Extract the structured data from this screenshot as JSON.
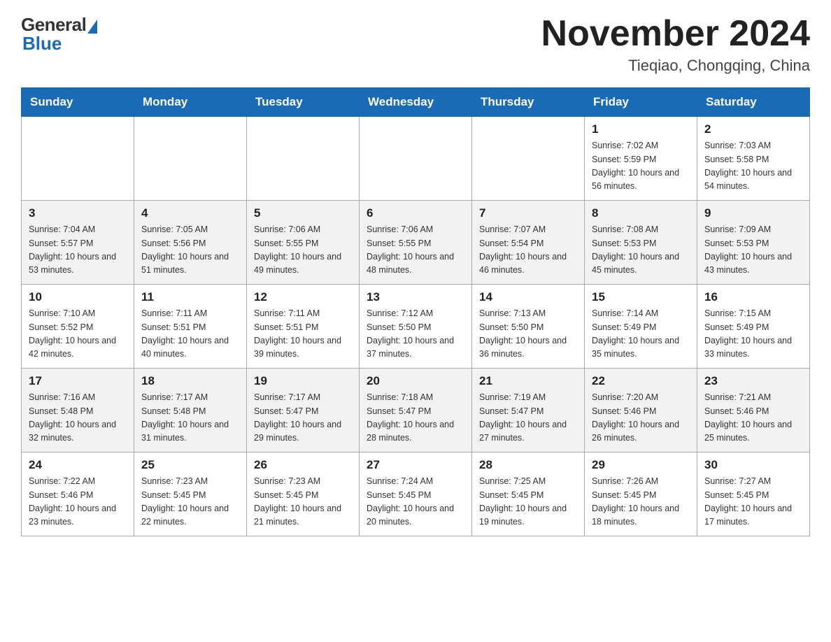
{
  "header": {
    "logo_general": "General",
    "logo_blue": "Blue",
    "month_title": "November 2024",
    "location": "Tieqiao, Chongqing, China"
  },
  "weekdays": [
    "Sunday",
    "Monday",
    "Tuesday",
    "Wednesday",
    "Thursday",
    "Friday",
    "Saturday"
  ],
  "weeks": [
    [
      {
        "day": "",
        "info": ""
      },
      {
        "day": "",
        "info": ""
      },
      {
        "day": "",
        "info": ""
      },
      {
        "day": "",
        "info": ""
      },
      {
        "day": "",
        "info": ""
      },
      {
        "day": "1",
        "info": "Sunrise: 7:02 AM\nSunset: 5:59 PM\nDaylight: 10 hours and 56 minutes."
      },
      {
        "day": "2",
        "info": "Sunrise: 7:03 AM\nSunset: 5:58 PM\nDaylight: 10 hours and 54 minutes."
      }
    ],
    [
      {
        "day": "3",
        "info": "Sunrise: 7:04 AM\nSunset: 5:57 PM\nDaylight: 10 hours and 53 minutes."
      },
      {
        "day": "4",
        "info": "Sunrise: 7:05 AM\nSunset: 5:56 PM\nDaylight: 10 hours and 51 minutes."
      },
      {
        "day": "5",
        "info": "Sunrise: 7:06 AM\nSunset: 5:55 PM\nDaylight: 10 hours and 49 minutes."
      },
      {
        "day": "6",
        "info": "Sunrise: 7:06 AM\nSunset: 5:55 PM\nDaylight: 10 hours and 48 minutes."
      },
      {
        "day": "7",
        "info": "Sunrise: 7:07 AM\nSunset: 5:54 PM\nDaylight: 10 hours and 46 minutes."
      },
      {
        "day": "8",
        "info": "Sunrise: 7:08 AM\nSunset: 5:53 PM\nDaylight: 10 hours and 45 minutes."
      },
      {
        "day": "9",
        "info": "Sunrise: 7:09 AM\nSunset: 5:53 PM\nDaylight: 10 hours and 43 minutes."
      }
    ],
    [
      {
        "day": "10",
        "info": "Sunrise: 7:10 AM\nSunset: 5:52 PM\nDaylight: 10 hours and 42 minutes."
      },
      {
        "day": "11",
        "info": "Sunrise: 7:11 AM\nSunset: 5:51 PM\nDaylight: 10 hours and 40 minutes."
      },
      {
        "day": "12",
        "info": "Sunrise: 7:11 AM\nSunset: 5:51 PM\nDaylight: 10 hours and 39 minutes."
      },
      {
        "day": "13",
        "info": "Sunrise: 7:12 AM\nSunset: 5:50 PM\nDaylight: 10 hours and 37 minutes."
      },
      {
        "day": "14",
        "info": "Sunrise: 7:13 AM\nSunset: 5:50 PM\nDaylight: 10 hours and 36 minutes."
      },
      {
        "day": "15",
        "info": "Sunrise: 7:14 AM\nSunset: 5:49 PM\nDaylight: 10 hours and 35 minutes."
      },
      {
        "day": "16",
        "info": "Sunrise: 7:15 AM\nSunset: 5:49 PM\nDaylight: 10 hours and 33 minutes."
      }
    ],
    [
      {
        "day": "17",
        "info": "Sunrise: 7:16 AM\nSunset: 5:48 PM\nDaylight: 10 hours and 32 minutes."
      },
      {
        "day": "18",
        "info": "Sunrise: 7:17 AM\nSunset: 5:48 PM\nDaylight: 10 hours and 31 minutes."
      },
      {
        "day": "19",
        "info": "Sunrise: 7:17 AM\nSunset: 5:47 PM\nDaylight: 10 hours and 29 minutes."
      },
      {
        "day": "20",
        "info": "Sunrise: 7:18 AM\nSunset: 5:47 PM\nDaylight: 10 hours and 28 minutes."
      },
      {
        "day": "21",
        "info": "Sunrise: 7:19 AM\nSunset: 5:47 PM\nDaylight: 10 hours and 27 minutes."
      },
      {
        "day": "22",
        "info": "Sunrise: 7:20 AM\nSunset: 5:46 PM\nDaylight: 10 hours and 26 minutes."
      },
      {
        "day": "23",
        "info": "Sunrise: 7:21 AM\nSunset: 5:46 PM\nDaylight: 10 hours and 25 minutes."
      }
    ],
    [
      {
        "day": "24",
        "info": "Sunrise: 7:22 AM\nSunset: 5:46 PM\nDaylight: 10 hours and 23 minutes."
      },
      {
        "day": "25",
        "info": "Sunrise: 7:23 AM\nSunset: 5:45 PM\nDaylight: 10 hours and 22 minutes."
      },
      {
        "day": "26",
        "info": "Sunrise: 7:23 AM\nSunset: 5:45 PM\nDaylight: 10 hours and 21 minutes."
      },
      {
        "day": "27",
        "info": "Sunrise: 7:24 AM\nSunset: 5:45 PM\nDaylight: 10 hours and 20 minutes."
      },
      {
        "day": "28",
        "info": "Sunrise: 7:25 AM\nSunset: 5:45 PM\nDaylight: 10 hours and 19 minutes."
      },
      {
        "day": "29",
        "info": "Sunrise: 7:26 AM\nSunset: 5:45 PM\nDaylight: 10 hours and 18 minutes."
      },
      {
        "day": "30",
        "info": "Sunrise: 7:27 AM\nSunset: 5:45 PM\nDaylight: 10 hours and 17 minutes."
      }
    ]
  ]
}
